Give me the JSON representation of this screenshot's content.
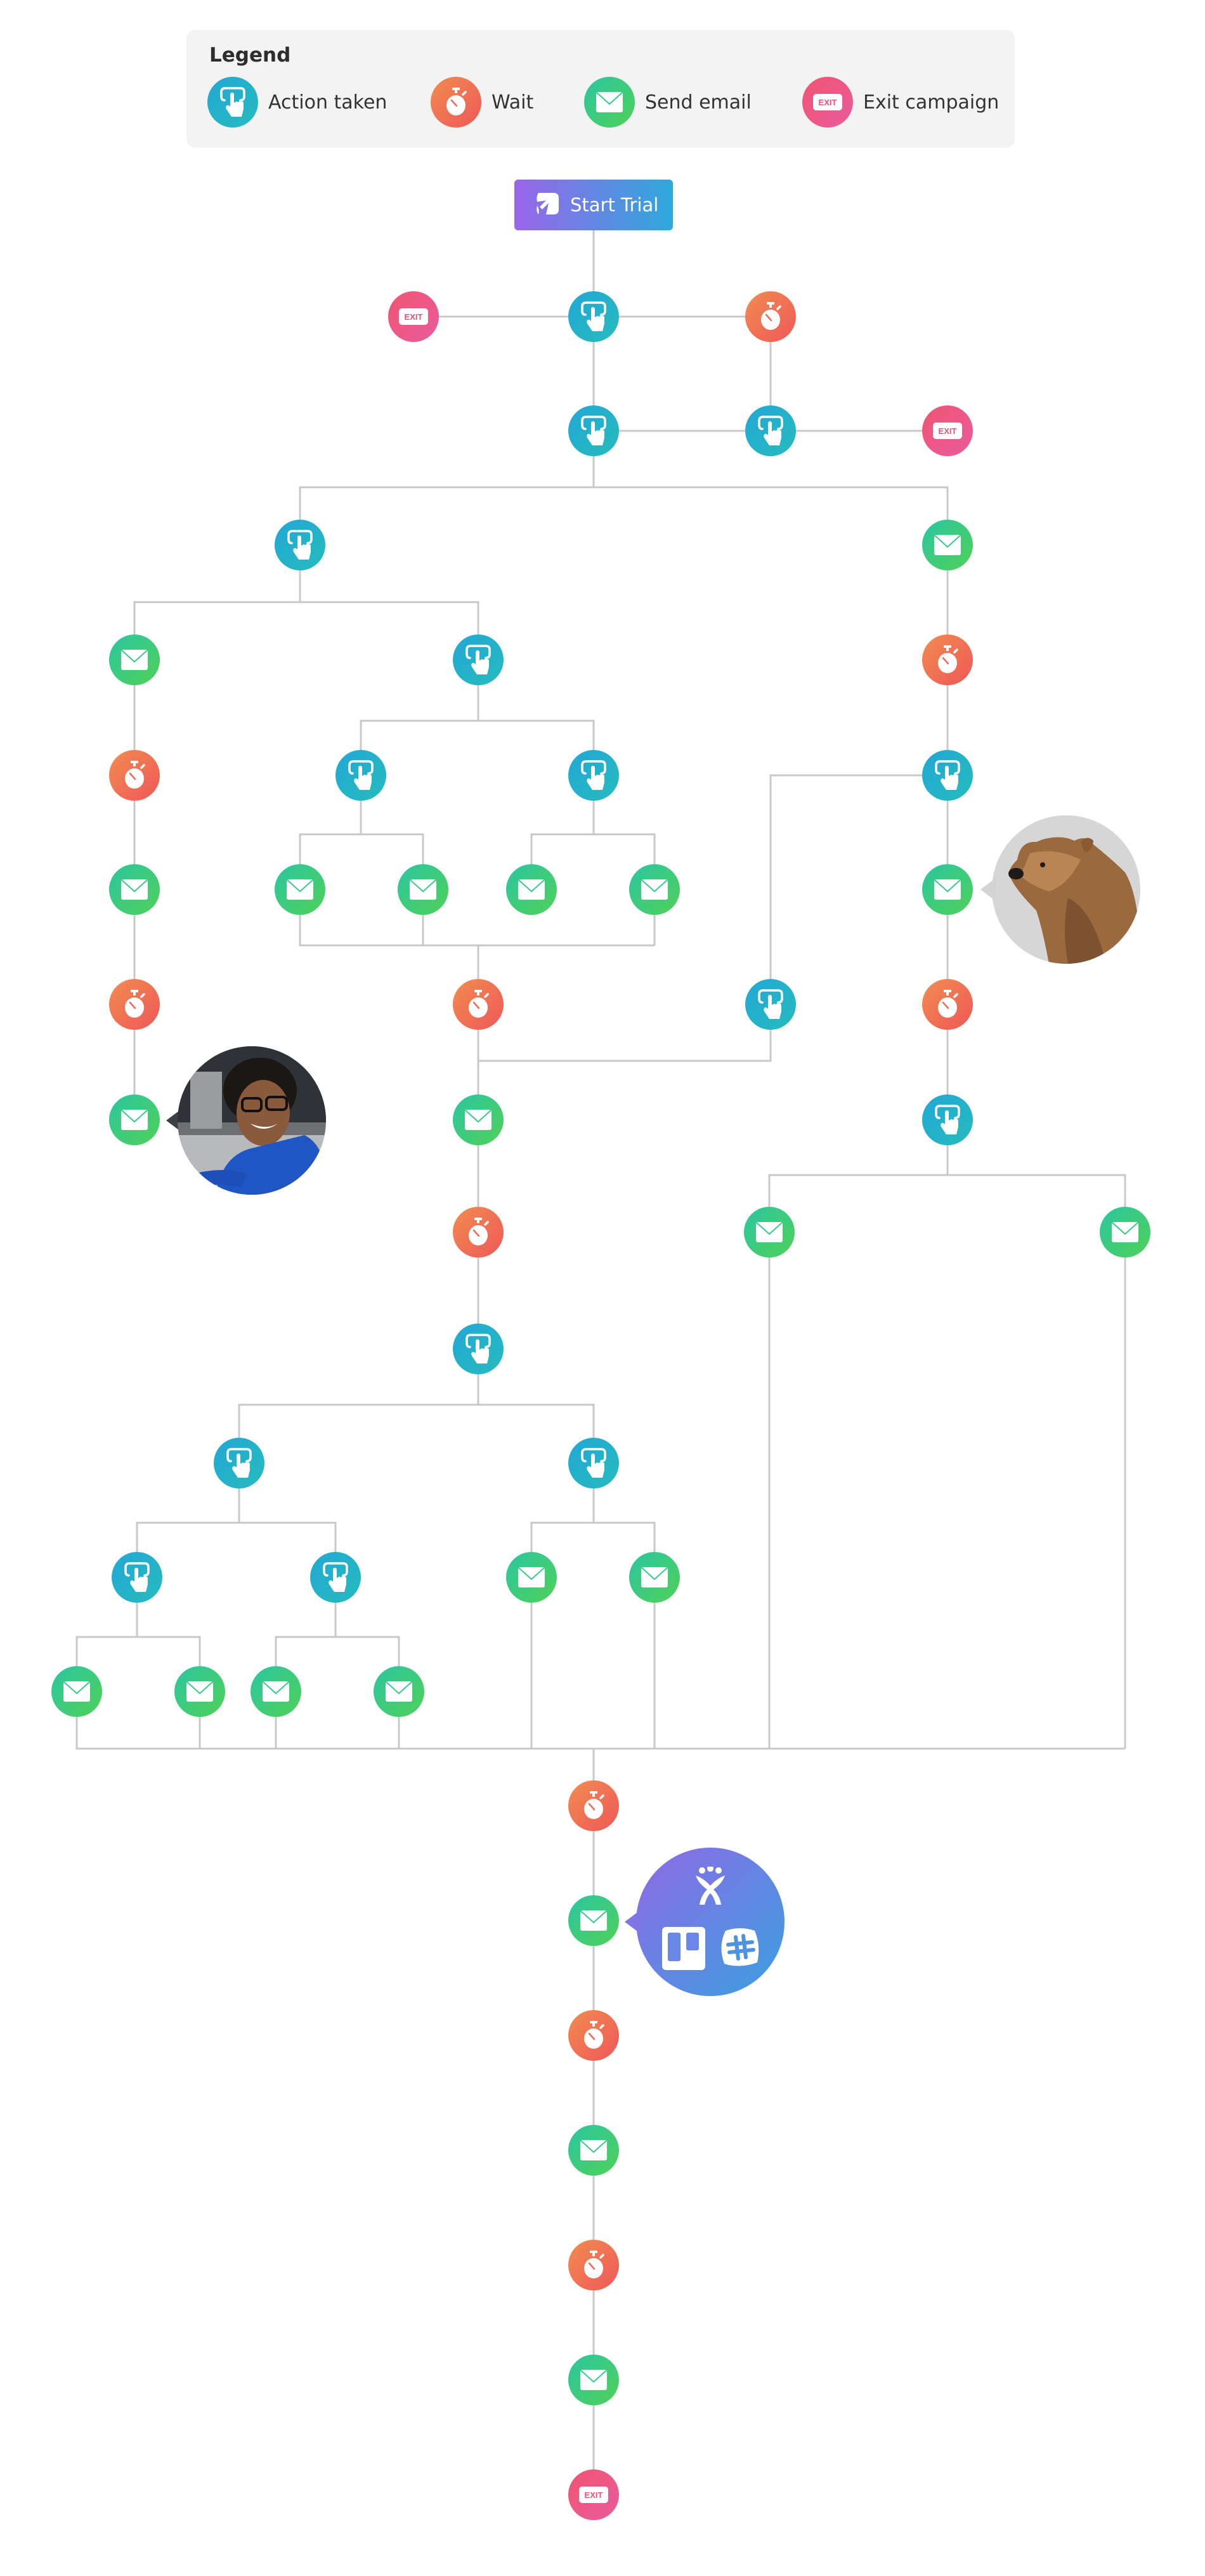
{
  "legend": {
    "title": "Legend",
    "items": [
      {
        "type": "action",
        "icon": "pointer-hand-icon",
        "label": "Action taken"
      },
      {
        "type": "wait",
        "icon": "stopwatch-icon",
        "label": "Wait"
      },
      {
        "type": "email",
        "icon": "envelope-icon",
        "label": "Send email"
      },
      {
        "type": "exit",
        "icon": "exit-sign-icon",
        "label": "Exit campaign"
      }
    ]
  },
  "start": {
    "label": "Start Trial",
    "icon": "trial-logo-icon"
  },
  "exit_badge_text": "EXIT",
  "colors": {
    "action": [
      "#24a7d6",
      "#25bcbd"
    ],
    "wait": [
      "#f28c50",
      "#ee5858"
    ],
    "email": [
      "#2bc6a1",
      "#50d158"
    ],
    "exit": [
      "#ef5570",
      "#eb5b9e"
    ],
    "start": [
      "#9a65ea",
      "#2ea8dc"
    ],
    "connector": "#c8c8c8"
  },
  "nodes": [
    {
      "id": "a1",
      "type": "action"
    },
    {
      "id": "x1",
      "type": "exit"
    },
    {
      "id": "w1",
      "type": "wait"
    },
    {
      "id": "a2",
      "type": "action"
    },
    {
      "id": "a3",
      "type": "action"
    },
    {
      "id": "x2",
      "type": "exit"
    },
    {
      "id": "a4",
      "type": "action"
    },
    {
      "id": "e1",
      "type": "email"
    },
    {
      "id": "e2",
      "type": "email"
    },
    {
      "id": "a5",
      "type": "action"
    },
    {
      "id": "w2",
      "type": "wait"
    },
    {
      "id": "w3",
      "type": "wait"
    },
    {
      "id": "a6",
      "type": "action"
    },
    {
      "id": "a7",
      "type": "action"
    },
    {
      "id": "a8",
      "type": "action"
    },
    {
      "id": "e3",
      "type": "email"
    },
    {
      "id": "e4",
      "type": "email"
    },
    {
      "id": "e5",
      "type": "email"
    },
    {
      "id": "e6",
      "type": "email"
    },
    {
      "id": "e7",
      "type": "email"
    },
    {
      "id": "e8",
      "type": "email"
    },
    {
      "id": "w4",
      "type": "wait"
    },
    {
      "id": "w5",
      "type": "wait"
    },
    {
      "id": "a9",
      "type": "action"
    },
    {
      "id": "w6",
      "type": "wait"
    },
    {
      "id": "e9",
      "type": "email"
    },
    {
      "id": "e10",
      "type": "email"
    },
    {
      "id": "a10",
      "type": "action"
    },
    {
      "id": "w7",
      "type": "wait"
    },
    {
      "id": "e11",
      "type": "email"
    },
    {
      "id": "e12",
      "type": "email"
    },
    {
      "id": "a11",
      "type": "action"
    },
    {
      "id": "a12",
      "type": "action"
    },
    {
      "id": "a13",
      "type": "action"
    },
    {
      "id": "a14",
      "type": "action"
    },
    {
      "id": "a15",
      "type": "action"
    },
    {
      "id": "e13",
      "type": "email"
    },
    {
      "id": "e14",
      "type": "email"
    },
    {
      "id": "e15",
      "type": "email"
    },
    {
      "id": "e16",
      "type": "email"
    },
    {
      "id": "e17",
      "type": "email"
    },
    {
      "id": "e18",
      "type": "email"
    },
    {
      "id": "w8",
      "type": "wait"
    },
    {
      "id": "e19",
      "type": "email"
    },
    {
      "id": "w9",
      "type": "wait"
    },
    {
      "id": "e20",
      "type": "email"
    },
    {
      "id": "w10",
      "type": "wait"
    },
    {
      "id": "e21",
      "type": "email"
    },
    {
      "id": "x3",
      "type": "exit"
    }
  ],
  "annotations": [
    {
      "id": "bear",
      "kind": "photo",
      "subject": "brown bear",
      "attached_to": "e8"
    },
    {
      "id": "woman",
      "kind": "photo",
      "subject": "smiling woman with glasses",
      "attached_to": "e6"
    },
    {
      "id": "apps",
      "kind": "integrations",
      "icons": [
        "jira-service-desk-icon",
        "trello-icon",
        "slack-icon"
      ],
      "attached_to": "e19"
    }
  ]
}
